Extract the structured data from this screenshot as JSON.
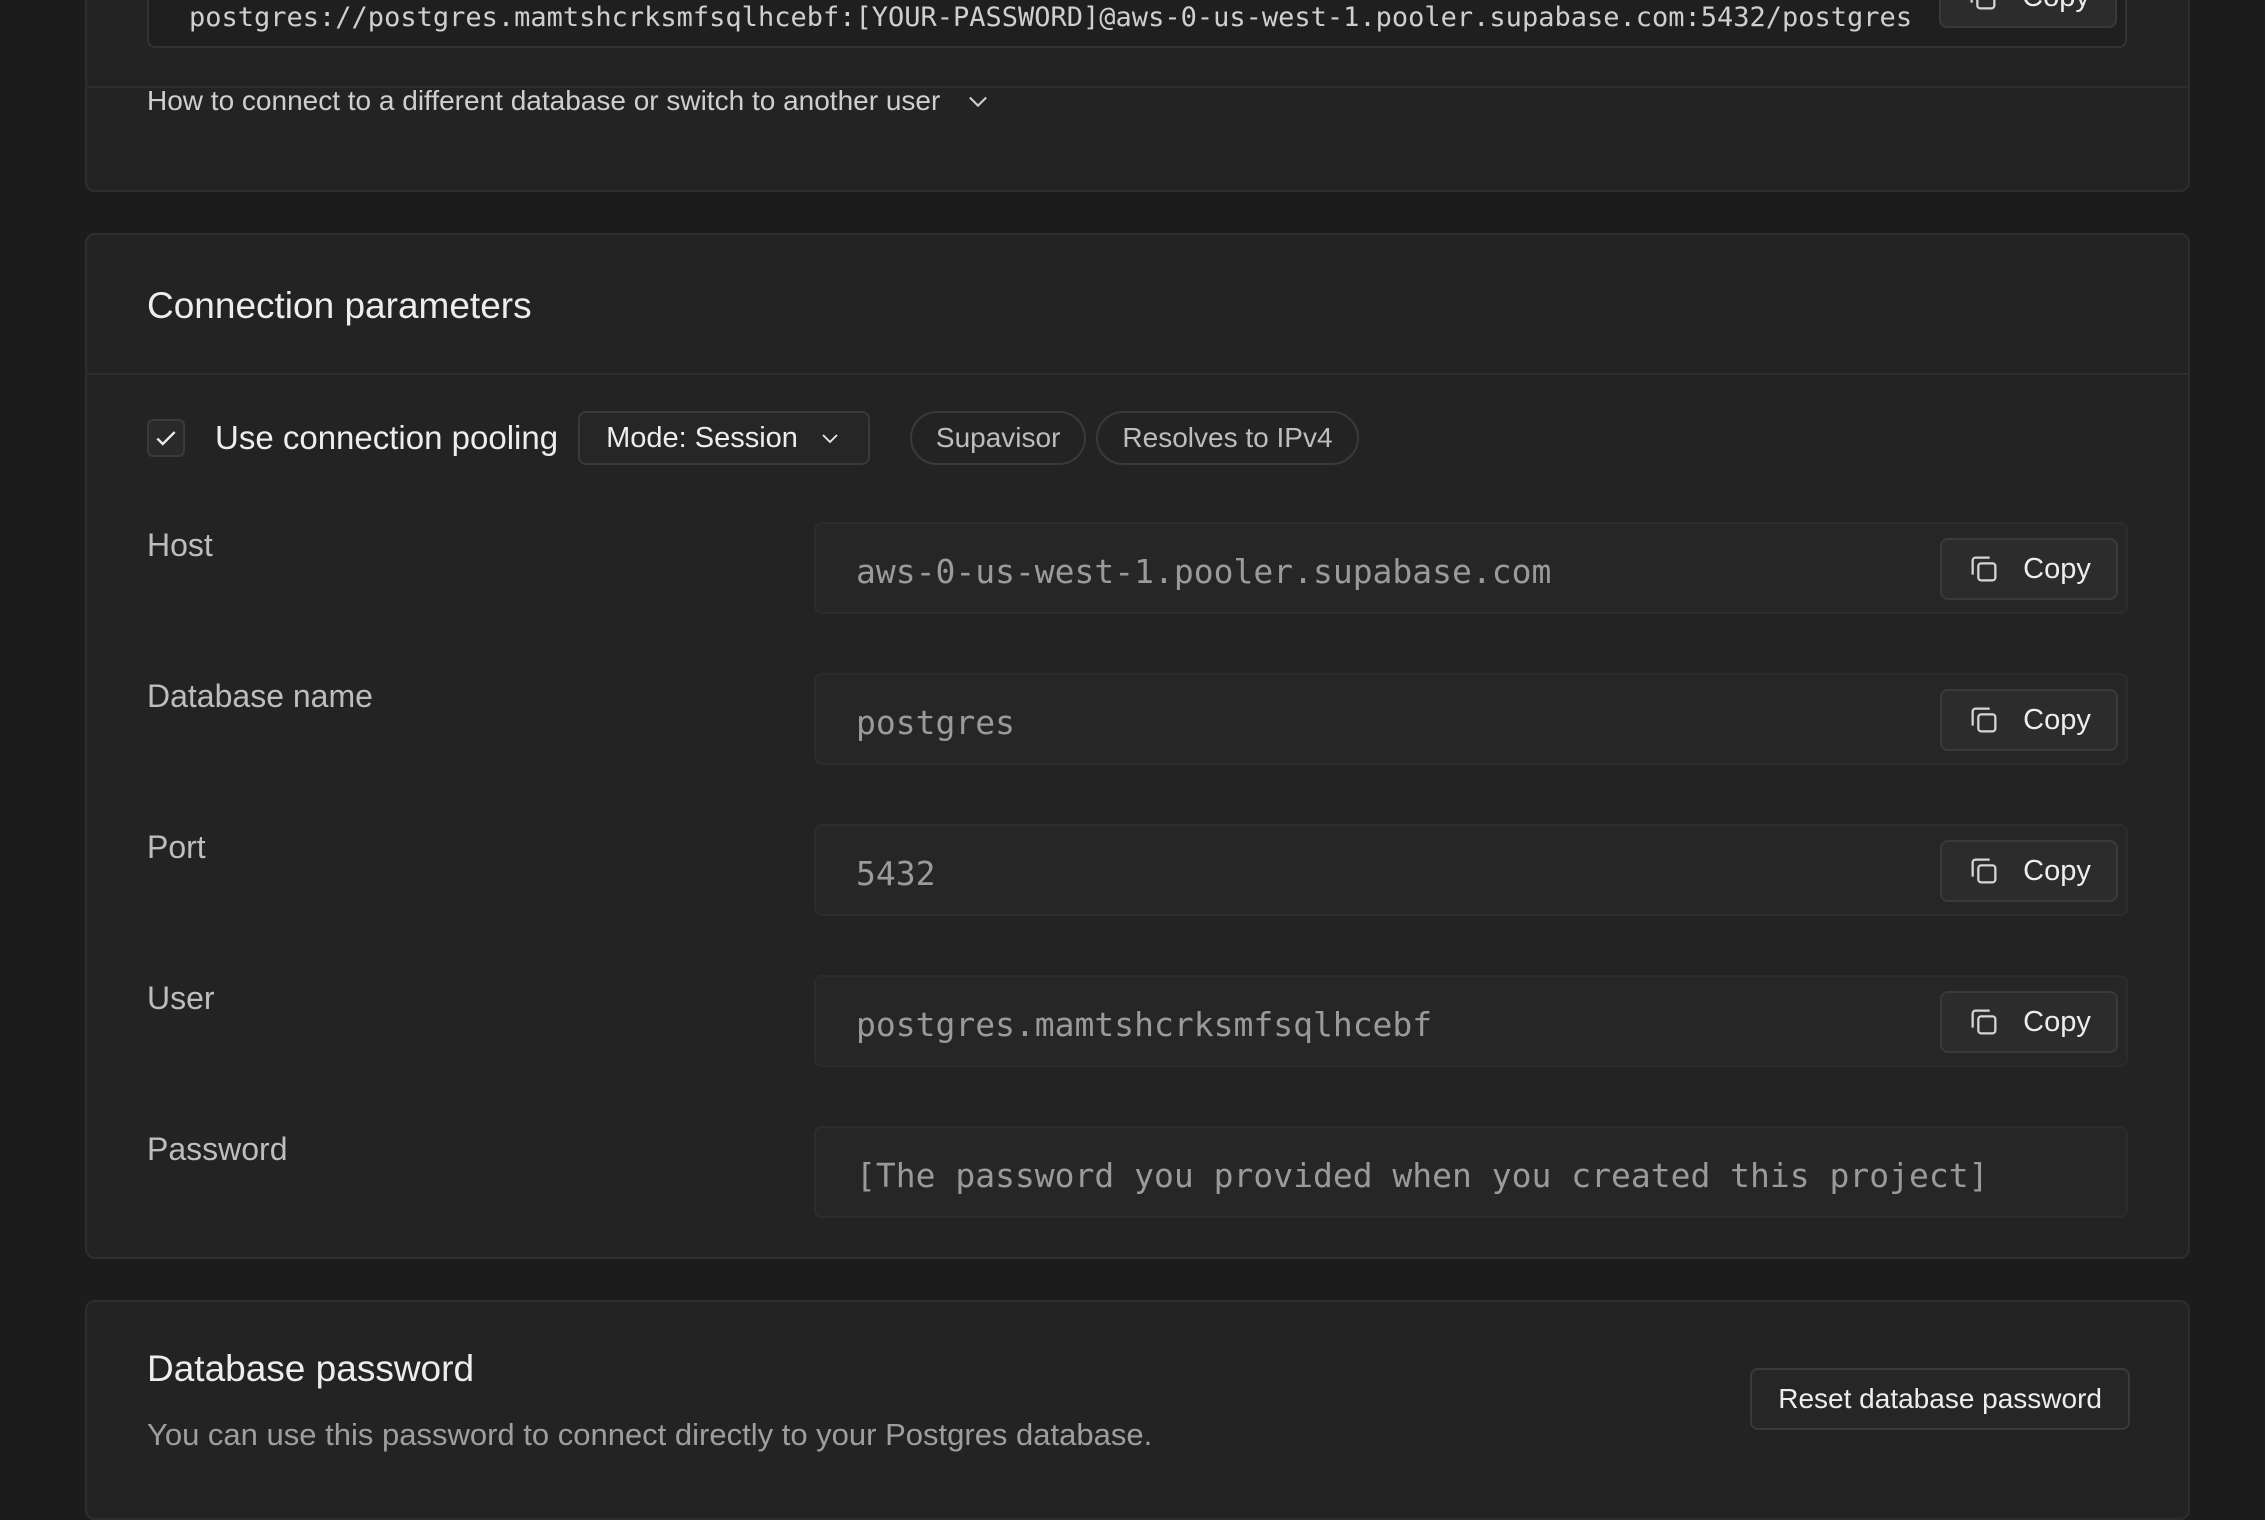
{
  "connection_string": {
    "value": "postgres://postgres.mamtshcrksmfsqlhcebf:[YOUR-PASSWORD]@aws-0-us-west-1.pooler.supabase.com:5432/postgres",
    "copy_label": "Copy"
  },
  "howto": {
    "label": "How to connect to a different database or switch to another user"
  },
  "params": {
    "title": "Connection parameters",
    "pooling_label": "Use connection pooling",
    "pooling_checked": true,
    "mode_label": "Mode: Session",
    "badges": [
      "Supavisor",
      "Resolves to IPv4"
    ],
    "fields": [
      {
        "label": "Host",
        "value": "aws-0-us-west-1.pooler.supabase.com",
        "copy": "Copy"
      },
      {
        "label": "Database name",
        "value": "postgres",
        "copy": "Copy"
      },
      {
        "label": "Port",
        "value": "5432",
        "copy": "Copy"
      },
      {
        "label": "User",
        "value": "postgres.mamtshcrksmfsqlhcebf",
        "copy": "Copy"
      },
      {
        "label": "Password",
        "value": "[The password you provided when you created this project]"
      }
    ]
  },
  "db_password": {
    "title": "Database password",
    "description": "You can use this password to connect directly to your Postgres database.",
    "reset_label": "Reset database password"
  },
  "icons": [
    "copy-icon",
    "chevron-down-icon",
    "check-icon"
  ]
}
